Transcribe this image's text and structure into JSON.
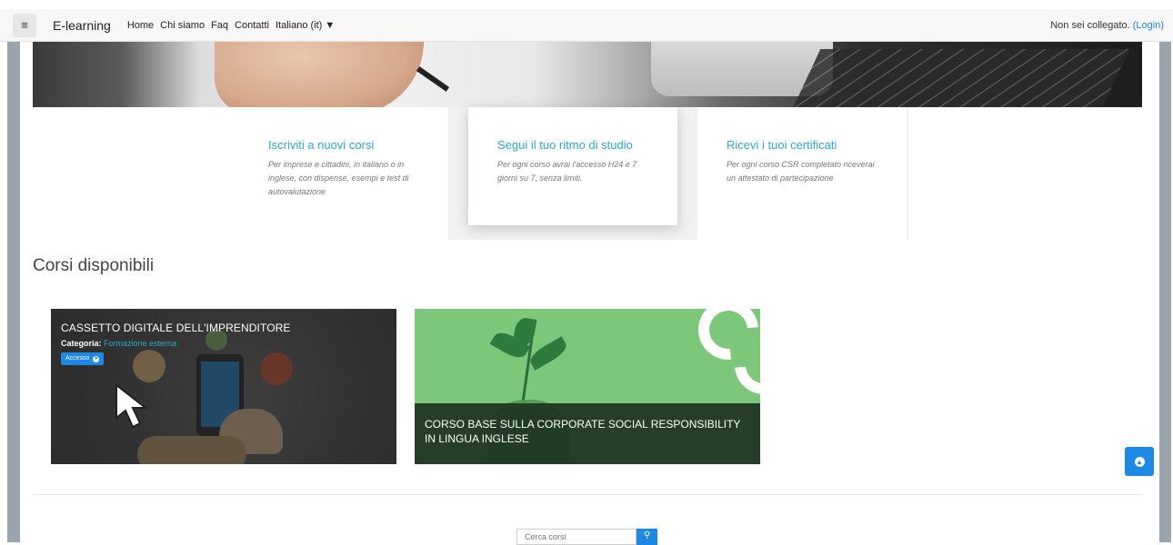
{
  "navbar": {
    "menu_icon": "hamburger-icon",
    "brand": "E-learning",
    "links": [
      "Home",
      "Chi siamo",
      "Faq",
      "Contatti"
    ],
    "language": "Italiano (it)",
    "login_text": "Non sei collegato.",
    "login_link": "(Login)"
  },
  "features": [
    {
      "title": "Iscriviti a nuovi corsi",
      "text": "Per imprese e cittadini, in italiano o in inglese, con dispense, esempi e test di autovalutazione"
    },
    {
      "title": "Segui il tuo ritmo di studio",
      "text": "Per ogni corso avrai l'accesso H24 e 7 giorni su 7, senza limiti."
    },
    {
      "title": "Ricevi i tuoi certificati",
      "text": "Per ogni corso CSR completato riceverai un attestato di partecipazione"
    }
  ],
  "courses_section": {
    "title": "Corsi disponibili",
    "courses": [
      {
        "name": "CASSETTO DIGITALE DELL'IMPRENDITORE",
        "category_label": "Categoria:",
        "category": "Formazione esterna",
        "button": "Accesso"
      },
      {
        "name": "CORSO BASE SULLA CORPORATE SOCIAL RESPONSIBILITY IN LINGUA INGLESE"
      }
    ]
  },
  "search": {
    "placeholder": "Cerca corsi"
  },
  "colors": {
    "accent": "#1e88e5",
    "link": "#29a9d6"
  }
}
